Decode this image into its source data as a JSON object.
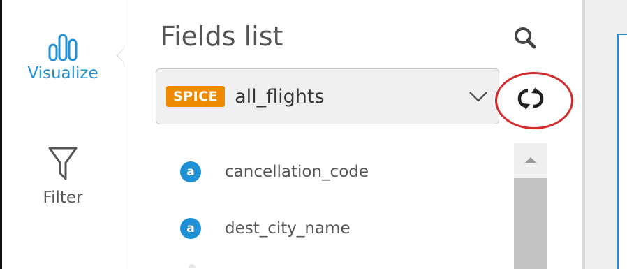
{
  "sidebar": {
    "items": [
      {
        "label": "Visualize",
        "icon": "bar-chart-icon",
        "active": true
      },
      {
        "label": "Filter",
        "icon": "funnel-icon",
        "active": false
      }
    ]
  },
  "panel": {
    "title": "Fields list",
    "search_icon": "search-icon",
    "refresh_icon": "refresh-icon",
    "dataset": {
      "badge": "SPICE",
      "name": "all_flights"
    },
    "fields": [
      {
        "name": "cancellation_code",
        "type_glyph": "a"
      },
      {
        "name": "dest_city_name",
        "type_glyph": "a"
      }
    ]
  },
  "colors": {
    "accent": "#1e90d6",
    "badge": "#f08a00",
    "highlight": "#d62a2a"
  }
}
